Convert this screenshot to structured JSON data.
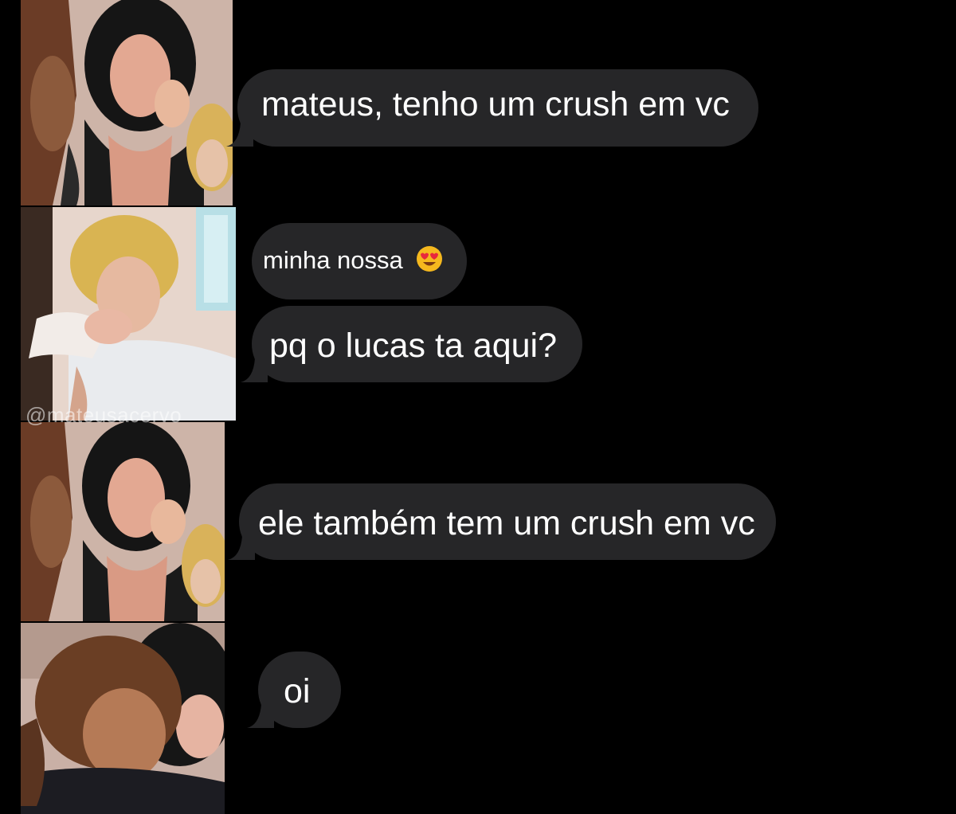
{
  "watermark": "@mateusacervo",
  "messages": [
    {
      "text": "mateus, tenho um crush em vc",
      "emoji": null
    },
    {
      "text": "minha nossa",
      "emoji": "smiling-face-with-heart-eyes"
    },
    {
      "text": "pq o lucas ta aqui?",
      "emoji": null
    },
    {
      "text": "ele também tem um crush em vc",
      "emoji": null
    },
    {
      "text": "oi",
      "emoji": null
    }
  ],
  "avatars": [
    {
      "subject": "dark-haired woman embraced by two men"
    },
    {
      "subject": "blond man kissing a hand"
    },
    {
      "subject": "dark-haired woman embraced by two men"
    },
    {
      "subject": "brown-haired man embracing woman"
    }
  ],
  "colors": {
    "background": "#000000",
    "bubble": "#262628",
    "bubble_text": "#ffffff"
  }
}
